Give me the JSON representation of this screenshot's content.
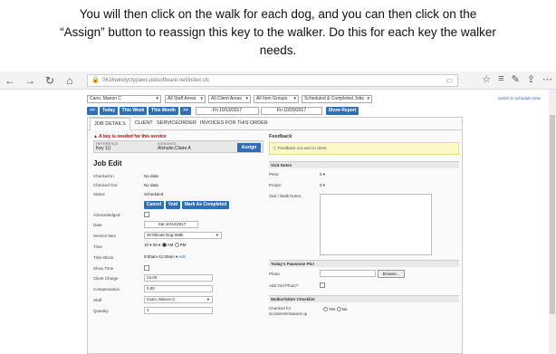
{
  "instructions": {
    "line1": "You will then click on the walk for each dog, and you can then click on the",
    "line2": "“Assign” button to reassign this key to the walker. Do this for each key the walker",
    "line3": "needs."
  },
  "browser": {
    "url": "0616windyctypaws.petsoftware.net/index.cfc"
  },
  "toolbar": {
    "staff_select": "Cano, Manon C",
    "all_staff_areas": "All Staff Areas",
    "all_client_areas": "All Client Areas",
    "all_item_groups": "All Item Groups",
    "jobs_filter": "Scheduled & Completed Jobs",
    "switch_link": "switch to schedule view",
    "prev": "<<",
    "today": "Today",
    "this_week": "This Week",
    "this_month": "This Month",
    "next": ">>",
    "date_from": "Fri 10/13/2017",
    "date_to": "Fri 10/20/2017",
    "show_report": "Show Report"
  },
  "tabs": [
    "JOB DETAILS",
    "CLIENT",
    "SERVICEORDER",
    "INVOICES FOR THIS ORDER"
  ],
  "job": {
    "alert": "A key is needed for this service",
    "ref_label": "REFERENCE",
    "ref_value": "Key 1()",
    "assigned_label": "ASSIGNED",
    "assigned_value": "Alshuler,Claire A",
    "assign_button": "Assign",
    "title": "Job Edit",
    "checked_in_label": "Checked In",
    "checked_in_value": "No data",
    "checked_out_label": "Checked Out",
    "checked_out_value": "No data",
    "status_label": "Status",
    "status_value": "Scheduled",
    "cancel": "Cancel",
    "void": "Void",
    "mark_completed": "Mark As Completed",
    "acknowledged_label": "Acknowledged",
    "date_label": "Date",
    "date_value": "Sat 10/14/2017",
    "service_item_label": "Service Item",
    "service_item_value": "30 Minute Dog Walk",
    "time_label": "Time",
    "time_hour": "10",
    "time_min": "00",
    "am": "AM",
    "pm": "PM",
    "time_block_label": "Time Block",
    "time_block_value": "9:00am-11:00am",
    "edit": "edit",
    "show_time_label": "Show Time",
    "client_charge_label": "Client Charge",
    "client_charge_value": "23.00",
    "compensation_label": "Compensation",
    "compensation_value": "0.00",
    "staff_label": "Staff",
    "staff_value": "Cano, Manon C",
    "quantity_label": "Quantity",
    "quantity_value": "1"
  },
  "feedback": {
    "title": "Feedback",
    "message": "Feedback not sent to client",
    "visit_notes_title": "Visit Notes",
    "pees_label": "Pees:",
    "pees_value": "0",
    "poops_label": "Poops:",
    "poops_value": "0",
    "visit_walk_notes_label": "Visit / Walk Notes:",
    "pawsome_title": "Today's Pawsome Pic!",
    "photo_label": "Photo",
    "browse": "Browse...",
    "add_2nd_photo_label": "Add 2nd Photo?",
    "checklist_title": "Walker/Sitter Checklist",
    "checked_for_label": "Checked for accidents/cleaned up",
    "yes": "Yes",
    "no": "No"
  }
}
